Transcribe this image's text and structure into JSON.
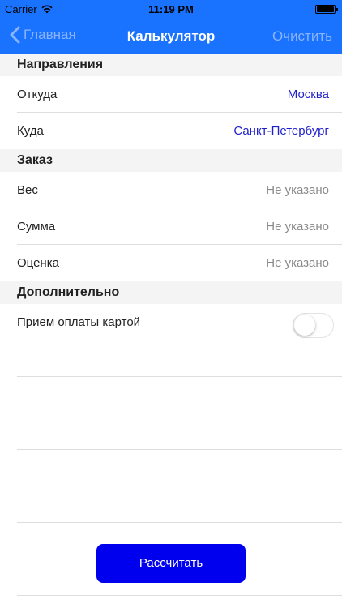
{
  "status_bar": {
    "carrier": "Carrier",
    "time": "11:19 PM",
    "battery_level": 1.0
  },
  "nav": {
    "back_label": "Главная",
    "title": "Калькулятор",
    "action_label": "Очистить"
  },
  "sections": {
    "directions": {
      "title": "Направления",
      "from_label": "Откуда",
      "from_value": "Москва",
      "to_label": "Куда",
      "to_value": "Санкт-Петербург"
    },
    "order": {
      "title": "Заказ",
      "weight_label": "Вес",
      "weight_value": "Не указано",
      "sum_label": "Сумма",
      "sum_value": "Не указано",
      "rating_label": "Оценка",
      "rating_value": "Не указано"
    },
    "extra": {
      "title": "Дополнительно",
      "card_payment_label": "Прием оплаты картой",
      "card_payment_enabled": false
    }
  },
  "calculate_button": {
    "label": "Рассчитать"
  },
  "colors": {
    "nav_background": "#1a73ff",
    "link_value": "#1f1fcc",
    "muted_value": "#8a8a8a",
    "button_background": "#0000ee"
  }
}
